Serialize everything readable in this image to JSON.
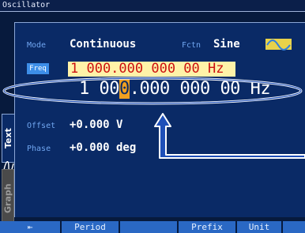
{
  "window": {
    "title": "Oscillator"
  },
  "settings": {
    "mode_label": "Mode",
    "mode_value": "Continuous",
    "fctn_label": "Fctn",
    "fctn_value": "Sine",
    "freq_label": "Freq",
    "freq_value": "1 000.000 000 00 Hz",
    "offset_label": "Offset",
    "offset_value": "+0.000 V",
    "phase_label": "Phase",
    "phase_value": "+0.000 deg"
  },
  "edit": {
    "before_cursor": "1 00",
    "cursor_digit": "0",
    "after_cursor": ".000 000 00 Hz"
  },
  "side_tabs": {
    "text": "Text",
    "graph": "Graph"
  },
  "softkeys": [
    {
      "label": "⇤"
    },
    {
      "label": "Period"
    },
    {
      "label": ""
    },
    {
      "label": "Prefix"
    },
    {
      "label": "Unit"
    },
    {
      "label": ""
    }
  ],
  "colors": {
    "panel": "#0a2a66",
    "label": "#70a6f0",
    "freq_background": "#fff2a8",
    "freq_text": "#cc1111",
    "cursor": "#f0a020",
    "annotation": "#ffffff"
  }
}
